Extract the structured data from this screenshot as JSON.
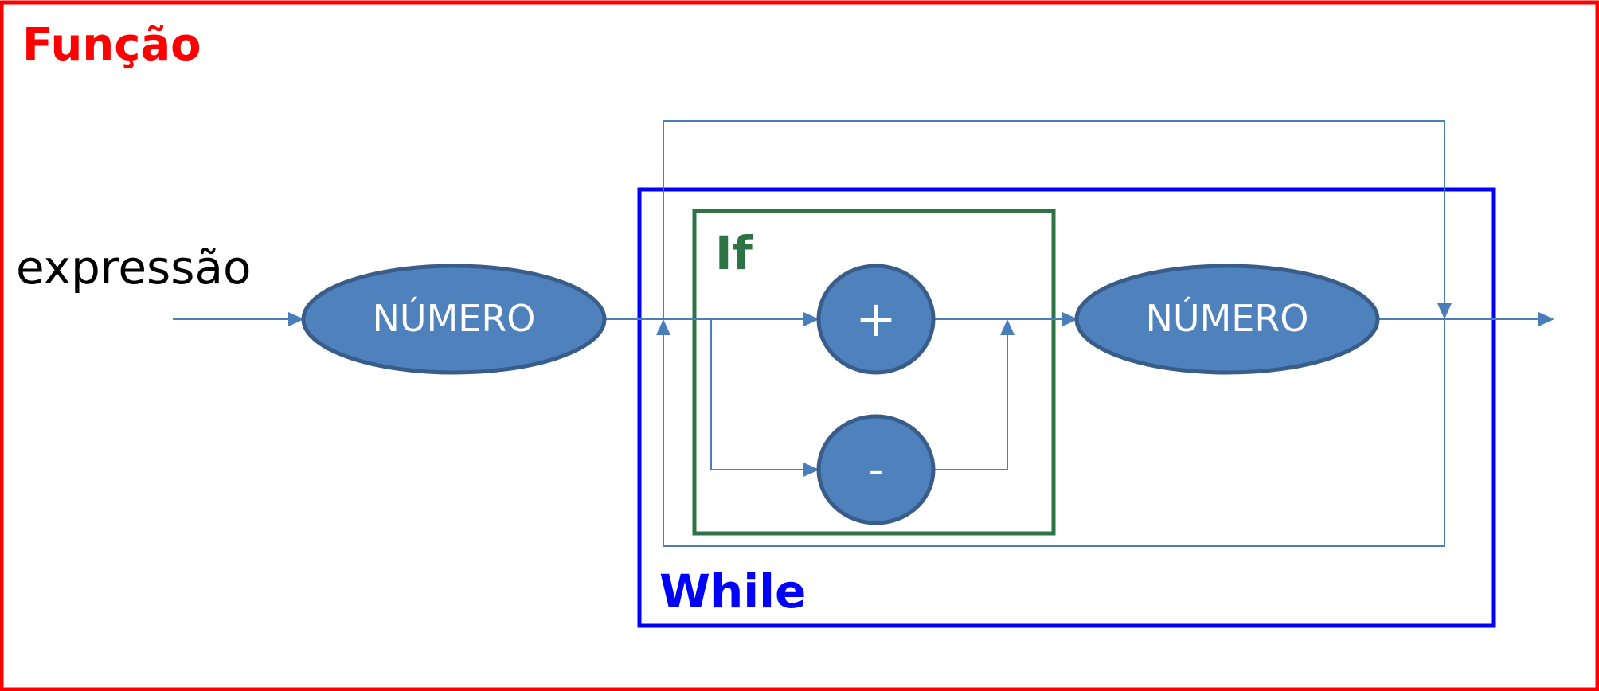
{
  "diagram": {
    "function_label": "Função",
    "while_label": "While",
    "if_label": "If",
    "input_label": "expressão",
    "node_number_1": "NÚMERO",
    "node_plus": "+",
    "node_minus": "-",
    "node_number_2": "NÚMERO"
  },
  "colors": {
    "function_frame": "#ff0000",
    "while_frame": "#0000ff",
    "if_frame": "#2e7346",
    "node_fill": "#4f81bd",
    "node_stroke": "#385d8a",
    "connector": "#4a7ebb",
    "node_text": "#ffffff"
  }
}
